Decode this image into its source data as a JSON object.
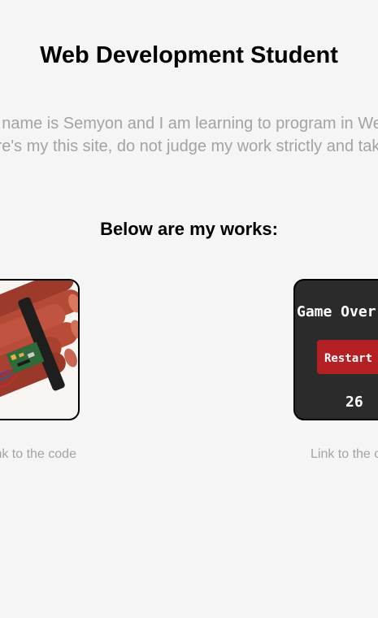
{
  "header": {
    "title": "Web Development Student"
  },
  "intro": {
    "line1": "My name is Semyon and I am learning to program in Web development.",
    "line2": "Here's my this site, do not judge my work strictly and take an interest."
  },
  "works": {
    "heading": "Below are my works:",
    "items": [
      {
        "image_subject": "dynamite-bundle-icon",
        "link_label": "Link to the code"
      },
      {
        "image_subject": "game-over-screen",
        "game_over_text": "Game Over",
        "restart_label": "Restart",
        "score": "26",
        "link_label": "Link to the code"
      }
    ]
  },
  "colors": {
    "background": "#f5f5f5",
    "muted_text": "#a3a3a3",
    "game_screen_bg": "#2b2b2b",
    "restart_button": "#b52025"
  }
}
